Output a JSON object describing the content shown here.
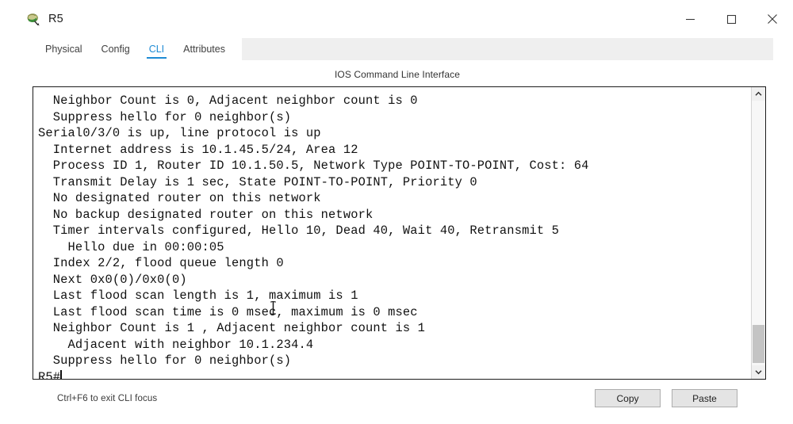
{
  "window": {
    "title": "R5",
    "icon": "router-device-icon",
    "controls": [
      {
        "name": "minimize-button",
        "glyph": "minimize-icon"
      },
      {
        "name": "maximize-button",
        "glyph": "maximize-icon"
      },
      {
        "name": "close-button",
        "glyph": "close-icon"
      }
    ]
  },
  "tabs": [
    {
      "label": "Physical",
      "active": false
    },
    {
      "label": "Config",
      "active": false
    },
    {
      "label": "CLI",
      "active": true
    },
    {
      "label": "Attributes",
      "active": false
    }
  ],
  "cli": {
    "caption": "IOS Command Line Interface",
    "lines": [
      "  Neighbor Count is 0, Adjacent neighbor count is 0",
      "  Suppress hello for 0 neighbor(s)",
      "Serial0/3/0 is up, line protocol is up",
      "  Internet address is 10.1.45.5/24, Area 12",
      "  Process ID 1, Router ID 10.1.50.5, Network Type POINT-TO-POINT, Cost: 64",
      "  Transmit Delay is 1 sec, State POINT-TO-POINT, Priority 0",
      "  No designated router on this network",
      "  No backup designated router on this network",
      "  Timer intervals configured, Hello 10, Dead 40, Wait 40, Retransmit 5",
      "    Hello due in 00:00:05",
      "  Index 2/2, flood queue length 0",
      "  Next 0x0(0)/0x0(0)",
      "  Last flood scan length is 1, maximum is 1",
      "  Last flood scan time is 0 msec, maximum is 0 msec",
      "  Neighbor Count is 1 , Adjacent neighbor count is 1",
      "    Adjacent with neighbor 10.1.234.4",
      "  Suppress hello for 0 neighbor(s)"
    ],
    "prompt": "R5#"
  },
  "scrollbar": {
    "up_arrow": "chevron-up-icon",
    "down_arrow": "chevron-down-icon"
  },
  "footer": {
    "hint": "Ctrl+F6 to exit CLI focus",
    "copy_label": "Copy",
    "paste_label": "Paste"
  },
  "colors": {
    "accent": "#1f8bd4",
    "panel": "#ffffff",
    "tabstrip_bg": "#efefef",
    "button_bg": "#e4e4e4",
    "terminal_border": "#1c1c1c"
  }
}
